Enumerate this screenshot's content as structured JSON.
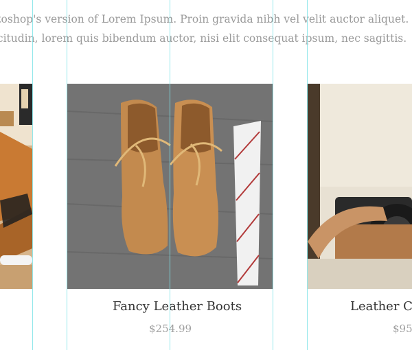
{
  "intro": {
    "line1": "otoshop's version  of Lorem Ipsum. Proin gravida nibh vel velit auctor aliquet.",
    "line2": "licitudin, lorem quis bibendum auctor, nisi elit consequat ipsum, nec sagittis."
  },
  "products": [
    {
      "image": "leather-craft-tools-photo",
      "title": "",
      "price": ""
    },
    {
      "image": "leather-boots-and-tie-photo",
      "title": "Fancy Leather Boots",
      "price": "$254.99"
    },
    {
      "image": "camera-with-leather-strap-photo",
      "title": "Leather Ca",
      "price": "$95"
    }
  ],
  "colors": {
    "guide": "#7fe3e8",
    "text": "#9a9a9a",
    "title": "#333333",
    "price": "#a0a0a0"
  }
}
